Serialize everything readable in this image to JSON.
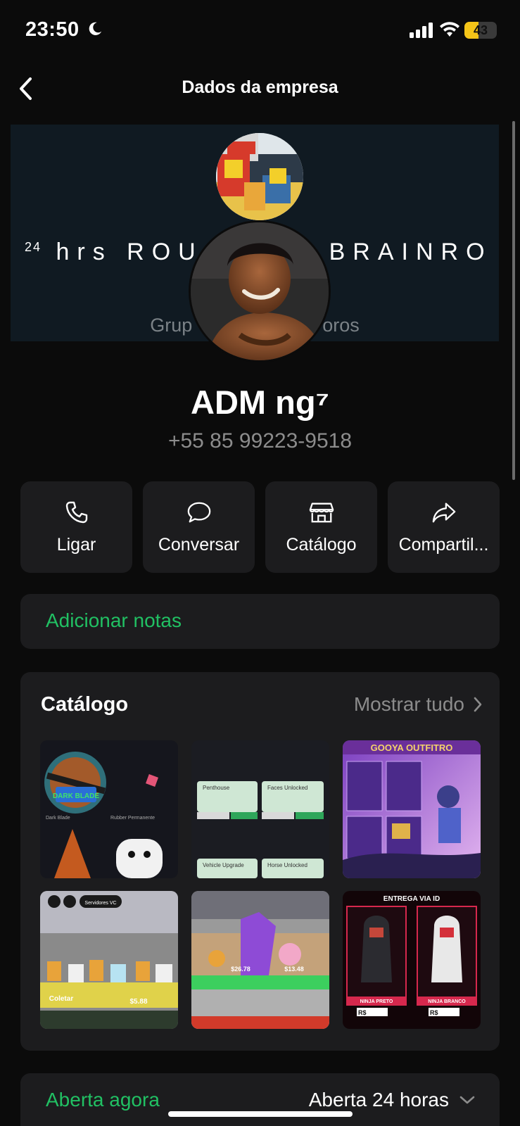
{
  "status_bar": {
    "time": "23:50",
    "battery": "43",
    "battery_level_percent": 43,
    "icons": [
      "moon-icon",
      "cellular-signal-icon",
      "wifi-icon",
      "battery-charging-icon"
    ]
  },
  "header": {
    "title": "Dados da empresa",
    "back_icon": "chevron-left-icon"
  },
  "cover": {
    "community_prefix": "24",
    "community_name_left": "hrs ROU",
    "community_name_right": "BRAINRO",
    "subtitle_left": "Grup",
    "subtitle_right": "oros"
  },
  "profile": {
    "name": "ADM ng⁷",
    "phone": "+55 85 99223-9518"
  },
  "actions": [
    {
      "label": "Ligar",
      "icon": "phone-icon"
    },
    {
      "label": "Conversar",
      "icon": "chat-bubble-icon"
    },
    {
      "label": "Catálogo",
      "icon": "storefront-icon"
    },
    {
      "label": "Compartil...",
      "icon": "share-icon"
    }
  ],
  "notes": {
    "label": "Adicionar notas"
  },
  "catalog": {
    "title": "Catálogo",
    "show_all": "Mostrar tudo",
    "items": [
      {
        "caption_1": "Dark Blade",
        "caption_2": "Rubber Permanente",
        "badge": "DARK BLADE"
      },
      {
        "caption_1": "Penthouse",
        "caption_2": "Faces Unlocked",
        "caption_3": "Vehicle Upgrade",
        "caption_4": "Horse Unlocked"
      },
      {
        "caption_1": "GOOYA OUTFITRO"
      },
      {
        "caption_1": "Servidores VC",
        "caption_2": "Coletar",
        "caption_3": "$5.88"
      },
      {
        "caption_1": "$26.78",
        "caption_2": "$13.48"
      },
      {
        "caption_1": "ENTREGA VIA ID",
        "caption_2": "NINJA PRETO",
        "caption_3": "NINJA BRANCO",
        "caption_4": "R$",
        "caption_5": "R$"
      }
    ],
    "colors": {
      "accent": "#21c063",
      "card": "#1c1c1e",
      "background": "#0b0b0b"
    }
  },
  "hours": {
    "status": "Aberta agora",
    "detail": "Aberta 24 horas"
  }
}
